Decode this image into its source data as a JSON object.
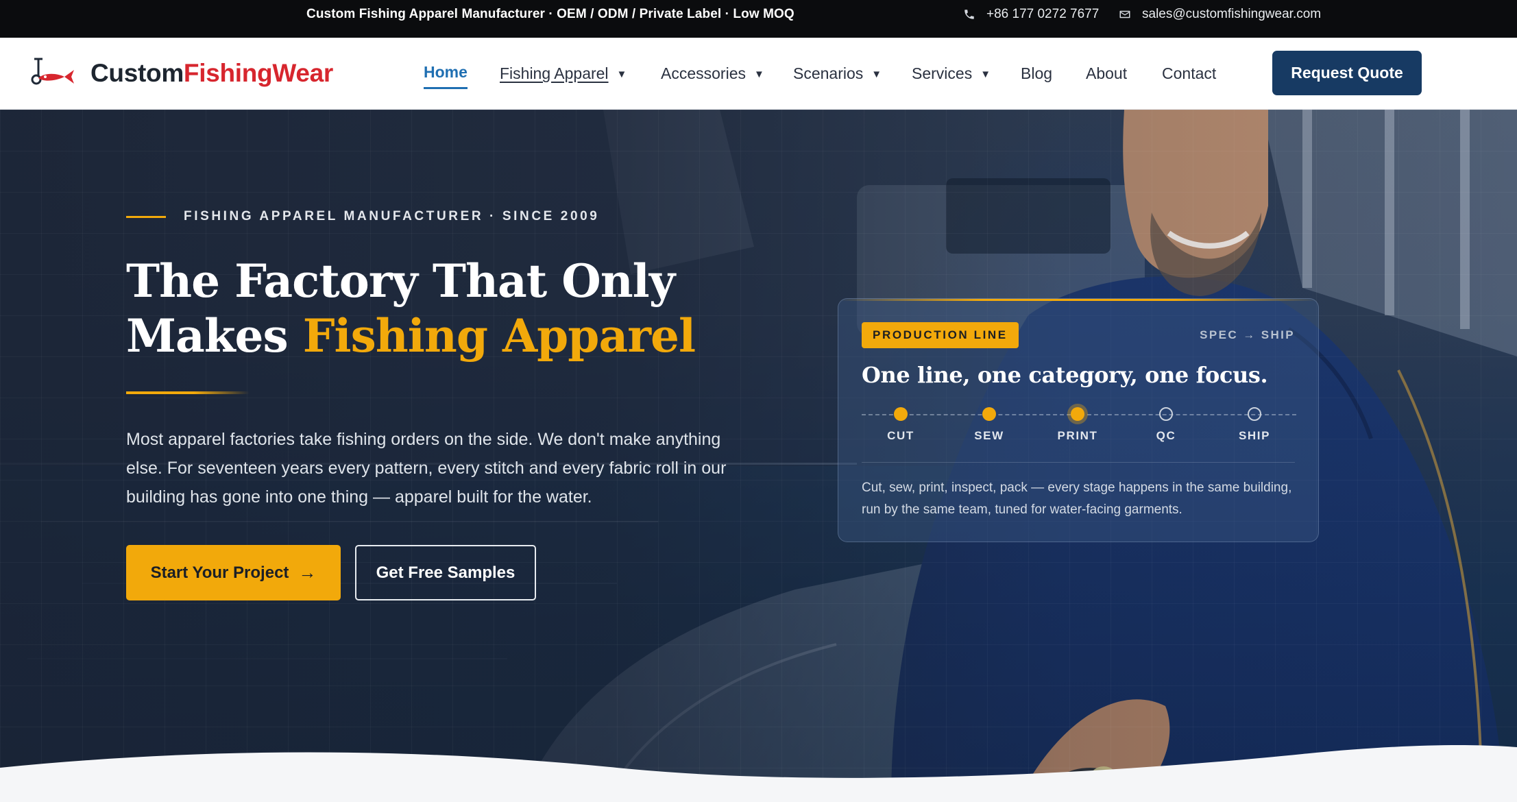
{
  "topbar": {
    "tagline": "Custom Fishing Apparel Manufacturer · OEM / ODM / Private Label · Low MOQ",
    "phone": "+86 177 0272 7677",
    "email": "sales@customfishingwear.com"
  },
  "brand": {
    "name_part1": "Custom",
    "name_part2": "FishingWear",
    "accent_color": "#d7262e"
  },
  "nav": {
    "items": [
      {
        "label": "Home"
      },
      {
        "label": "Fishing Apparel"
      },
      {
        "label": "Accessories"
      },
      {
        "label": "Scenarios"
      },
      {
        "label": "Services"
      },
      {
        "label": "Blog"
      },
      {
        "label": "About"
      },
      {
        "label": "Contact"
      }
    ],
    "cta": "Request Quote",
    "active_color": "#1f6fb2"
  },
  "hero": {
    "eyebrow": "FISHING APPAREL MANUFACTURER · SINCE 2009",
    "headline_line1": "The Factory That Only",
    "headline_line2_plain": "Makes ",
    "headline_line2_highlight": "Fishing Apparel",
    "lead": "Most apparel factories take fishing orders on the side. We don't make anything else. For seventeen years every pattern, every stitch and every fabric roll in our building has gone into one thing — apparel built for the water.",
    "primary_button": "Start Your Project",
    "secondary_button": "Get Free Samples",
    "accent_color": "#f2a90b"
  },
  "production_card": {
    "badge": "PRODUCTION LINE",
    "spec": "SPEC → SHIP",
    "title": "One line, one category, one focus.",
    "steps": [
      {
        "label": "CUT",
        "state": "done"
      },
      {
        "label": "SEW",
        "state": "done"
      },
      {
        "label": "PRINT",
        "state": "current"
      },
      {
        "label": "QC",
        "state": "todo"
      },
      {
        "label": "SHIP",
        "state": "todo"
      }
    ],
    "description": "Cut, sew, print, inspect, pack — every stage happens in the same building, run by the same team, tuned for water-facing garments."
  }
}
